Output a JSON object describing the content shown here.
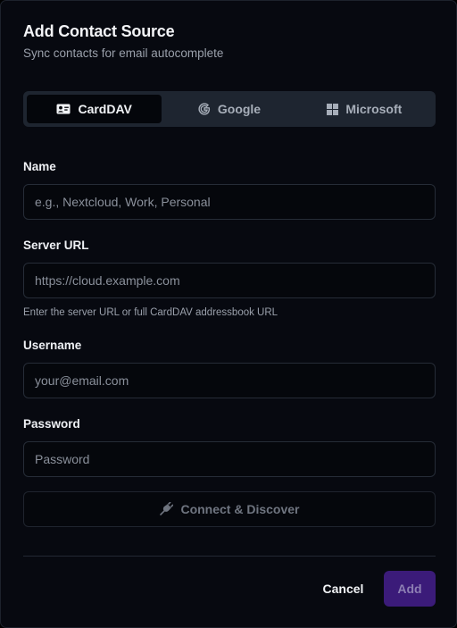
{
  "dialog": {
    "title": "Add Contact Source",
    "subtitle": "Sync contacts for email autocomplete"
  },
  "tabs": [
    {
      "label": "CardDAV",
      "icon": "contact-card-icon",
      "active": true
    },
    {
      "label": "Google",
      "icon": "google-g-icon",
      "active": false
    },
    {
      "label": "Microsoft",
      "icon": "microsoft-windows-icon",
      "active": false
    }
  ],
  "form": {
    "name": {
      "label": "Name",
      "placeholder": "e.g., Nextcloud, Work, Personal",
      "value": ""
    },
    "server_url": {
      "label": "Server URL",
      "placeholder": "https://cloud.example.com",
      "value": "",
      "hint": "Enter the server URL or full CardDAV addressbook URL"
    },
    "username": {
      "label": "Username",
      "placeholder": "your@email.com",
      "value": ""
    },
    "password": {
      "label": "Password",
      "placeholder": "Password",
      "value": ""
    }
  },
  "actions": {
    "connect_label": "Connect & Discover",
    "connect_icon": "plug-icon",
    "cancel_label": "Cancel",
    "add_label": "Add"
  },
  "colors": {
    "accent_disabled": "#3b1b79",
    "background": "#070910"
  }
}
